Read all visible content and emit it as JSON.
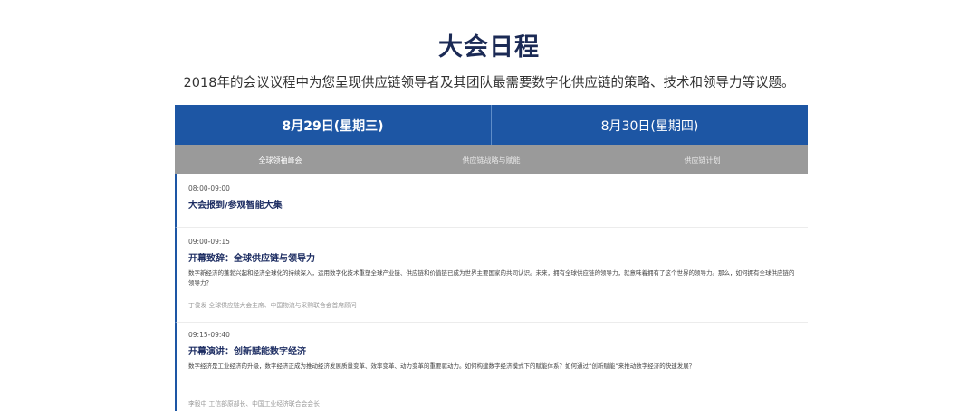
{
  "header": {
    "title": "大会日程",
    "subtitle": "2018年的会议议程中为您呈现供应链领导者及其团队最需要数字化供应链的策略、技术和领导力等议题。"
  },
  "day_tabs": [
    {
      "label": "8月29日(星期三)",
      "active": true
    },
    {
      "label": "8月30日(星期四)",
      "active": false
    }
  ],
  "track_tabs": [
    {
      "label": "全球领袖峰会",
      "active": true
    },
    {
      "label": "供应链战略与赋能",
      "active": false
    },
    {
      "label": "供应链计划",
      "active": false
    }
  ],
  "sessions": [
    {
      "time": "08:00-09:00",
      "title": "大会报到/参观智能大集"
    },
    {
      "time": "09:00-09:15",
      "title": "开幕致辞：全球供应链与领导力",
      "description": "数字新经济的蓬勃兴起和经济全球化的持续深入，运用数字化技术重塑全球产业链、供应链和价值链已成为世界主要国家的共同认识。未来，拥有全球供应链的领导力，就意味着拥有了这个世界的领导力。那么，如何拥有全球供应链的领导力？",
      "speaker": "丁俊发 全球供应链大会主席、中国物流与采购联合会首席顾问"
    },
    {
      "time": "09:15-09:40",
      "title": "开幕演讲：创新赋能数字经济",
      "description": "数字经济是工业经济的升级，数字经济正成为推动经济发展质量变革、效率变革、动力变革的重要驱动力。如何构建数字经济模式下的赋能体系？如何通过“创新赋能”来推动数字经济的快速发展？",
      "speaker": "李毅中 工信部原部长、中国工业经济联合会会长"
    }
  ],
  "colors": {
    "tab_blue": "#1d56a4",
    "track_gray": "#9a9a9a",
    "title_navy": "#1b2a55"
  }
}
